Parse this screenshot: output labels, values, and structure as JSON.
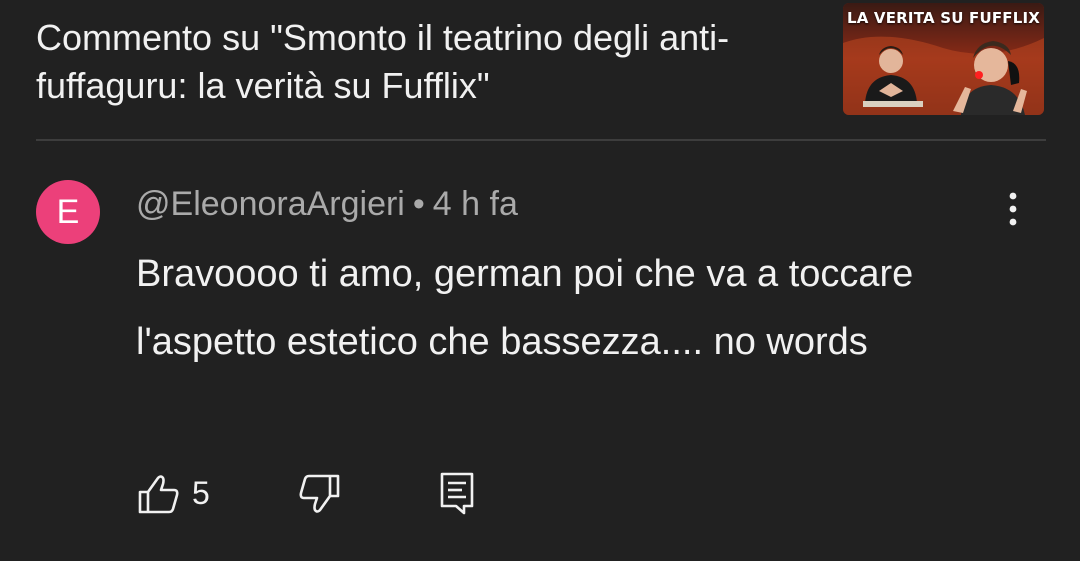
{
  "header": {
    "title": "Commento su \"Smonto il teatrino degli anti-fuffaguru: la verità su Fufflix\""
  },
  "thumbnail": {
    "overlay_text": "LA VERITA SU FUFFLIX"
  },
  "comment": {
    "avatar_letter": "E",
    "author": "@EleonoraArgieri",
    "separator": "•",
    "time": "4 h fa",
    "text": "Bravoooo ti amo, german poi che va a toccare l'aspetto estetico che bassezza.... no words",
    "like_count": "5"
  },
  "icons": {
    "menu": "more-vertical-icon",
    "like": "thumb-up-icon",
    "dislike": "thumb-down-icon",
    "reply": "reply-comment-icon"
  },
  "colors": {
    "background": "#212121",
    "avatar": "#ec407a",
    "text_primary": "#f1f1f1",
    "text_secondary": "#aaaaaa"
  }
}
